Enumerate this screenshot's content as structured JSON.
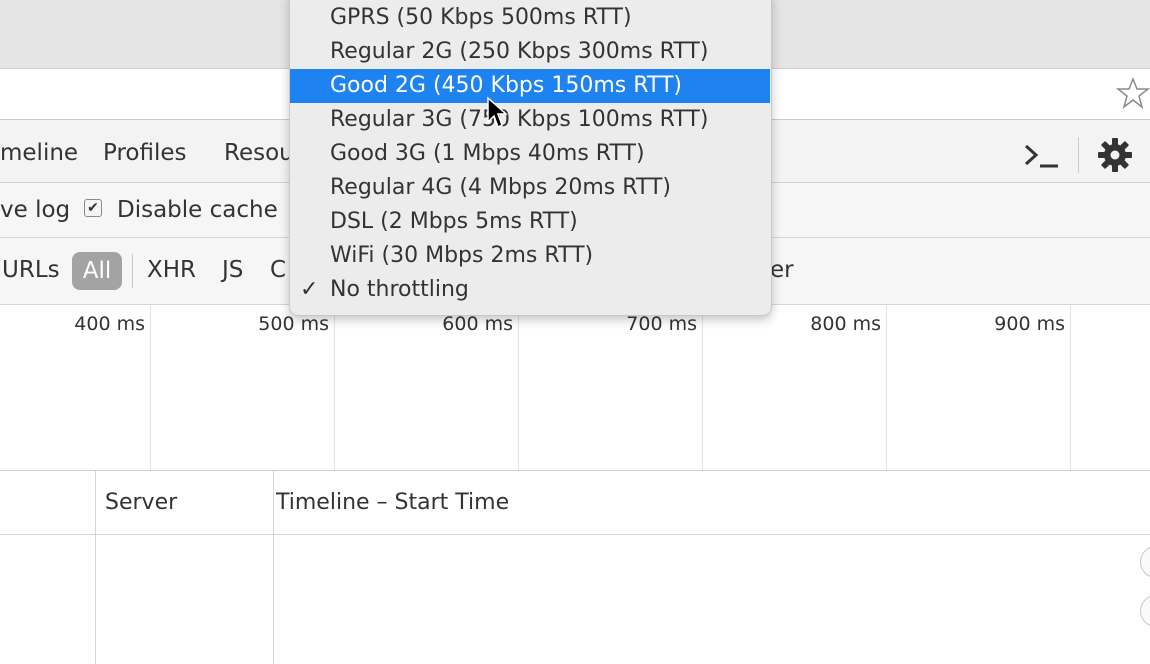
{
  "devtools": {
    "tabs": [
      "meline",
      "Profiles",
      "Resou"
    ],
    "toolbar": {
      "preserve_log_label": "ve log",
      "disable_cache_label": "Disable cache",
      "disable_cache_checked": true
    },
    "filters": {
      "urls_label": "URLs",
      "all_label": "All",
      "xhr_label": "XHR",
      "js_label": "JS",
      "css_partial": "C",
      "other_partial": "er"
    },
    "timeline_ticks": [
      "400 ms",
      "500 ms",
      "600 ms",
      "700 ms",
      "800 ms",
      "900 ms"
    ],
    "grid_columns": {
      "server": "Server",
      "timeline": "Timeline – Start Time"
    }
  },
  "throttle_menu": {
    "items": [
      {
        "label": "GPRS (50 Kbps 500ms RTT)",
        "highlighted": false,
        "checked": false
      },
      {
        "label": "Regular 2G (250 Kbps 300ms RTT)",
        "highlighted": false,
        "checked": false
      },
      {
        "label": "Good 2G (450 Kbps 150ms RTT)",
        "highlighted": true,
        "checked": false
      },
      {
        "label": "Regular 3G (750 Kbps 100ms RTT)",
        "highlighted": false,
        "checked": false
      },
      {
        "label": "Good 3G (1 Mbps 40ms RTT)",
        "highlighted": false,
        "checked": false
      },
      {
        "label": "Regular 4G (4 Mbps 20ms RTT)",
        "highlighted": false,
        "checked": false
      },
      {
        "label": "DSL (2 Mbps 5ms RTT)",
        "highlighted": false,
        "checked": false
      },
      {
        "label": "WiFi (30 Mbps 2ms RTT)",
        "highlighted": false,
        "checked": false
      },
      {
        "label": "No throttling",
        "highlighted": false,
        "checked": true
      }
    ],
    "check_glyph": "✓",
    "highlight_color": "#1e82f0"
  },
  "icons": [
    "star-icon",
    "console-icon",
    "gear-icon",
    "checkbox-check-icon",
    "mouse-cursor-icon"
  ]
}
